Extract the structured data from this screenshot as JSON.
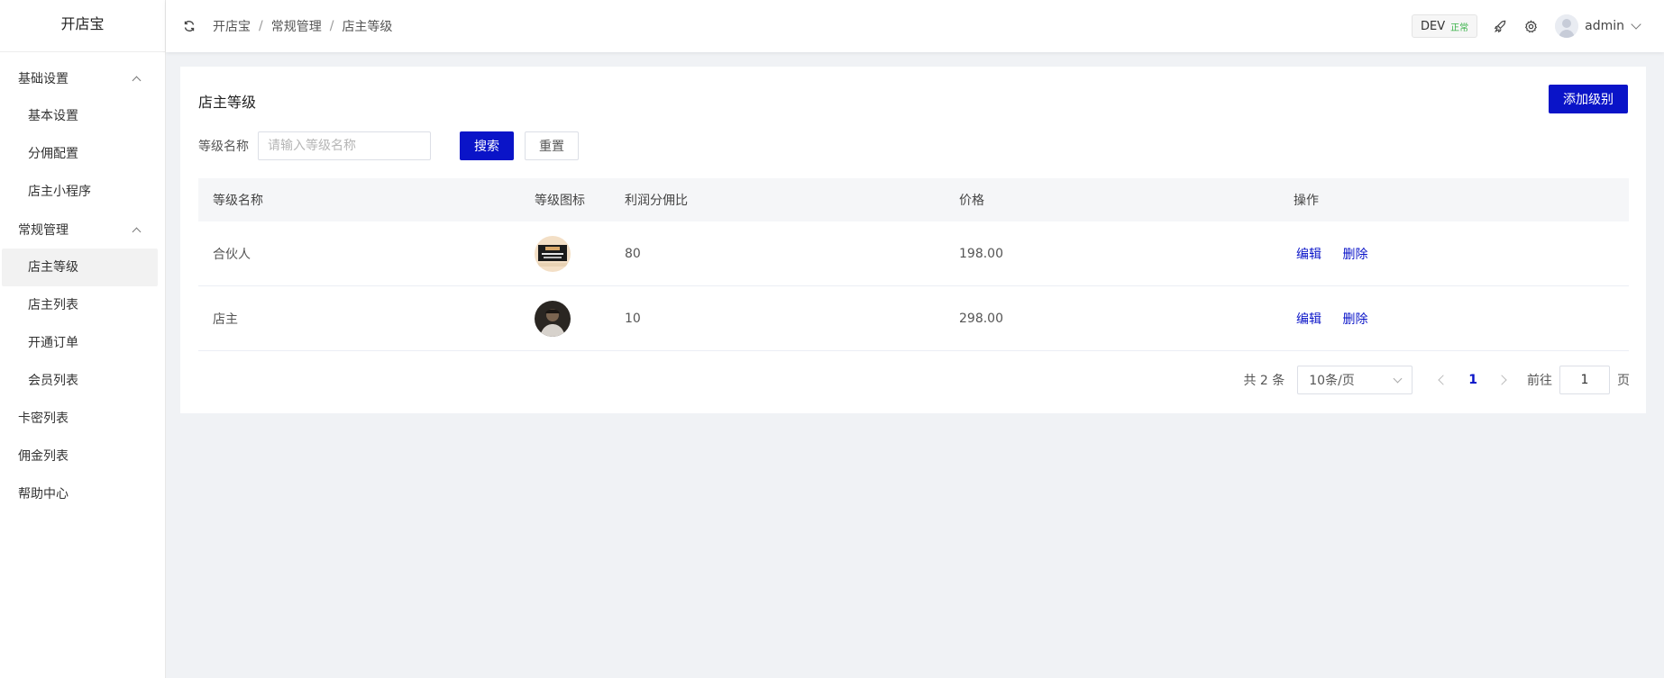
{
  "app": {
    "logo": "开店宝"
  },
  "sidebar": {
    "groups": [
      {
        "label": "基础设置",
        "items": [
          "基本设置",
          "分佣配置",
          "店主小程序"
        ]
      },
      {
        "label": "常规管理",
        "items": [
          "店主等级",
          "店主列表",
          "开通订单",
          "会员列表"
        ]
      }
    ],
    "top_items": [
      "卡密列表",
      "佣金列表",
      "帮助中心"
    ],
    "active_item": "店主等级"
  },
  "header": {
    "breadcrumb": [
      "开店宝",
      "常规管理",
      "店主等级"
    ],
    "breadcrumb_separator": "/",
    "env_label": "DEV",
    "env_status": "正常",
    "username": "admin",
    "icons": [
      "refresh-icon",
      "rocket-icon",
      "gear-icon",
      "avatar",
      "chevron-down-icon"
    ]
  },
  "page": {
    "title": "店主等级",
    "add_button": "添加级别",
    "filter": {
      "label": "等级名称",
      "placeholder": "请输入等级名称",
      "value": ""
    },
    "search_button": "搜索",
    "reset_button": "重置"
  },
  "table": {
    "columns": [
      "等级名称",
      "等级图标",
      "利润分佣比",
      "价格",
      "操作"
    ],
    "rows": [
      {
        "name": "合伙人",
        "ratio": "80",
        "price": "198.00",
        "edit": "编辑",
        "delete": "删除"
      },
      {
        "name": "店主",
        "ratio": "10",
        "price": "298.00",
        "edit": "编辑",
        "delete": "删除"
      }
    ]
  },
  "pagination": {
    "total_text": "共 2 条",
    "page_size": "10条/页",
    "current_page": "1",
    "goto_label": "前往",
    "goto_value": "1",
    "page_suffix": "页"
  },
  "colors": {
    "primary": "#0a14c8",
    "success": "#3bb34a",
    "background": "#f0f2f5"
  }
}
